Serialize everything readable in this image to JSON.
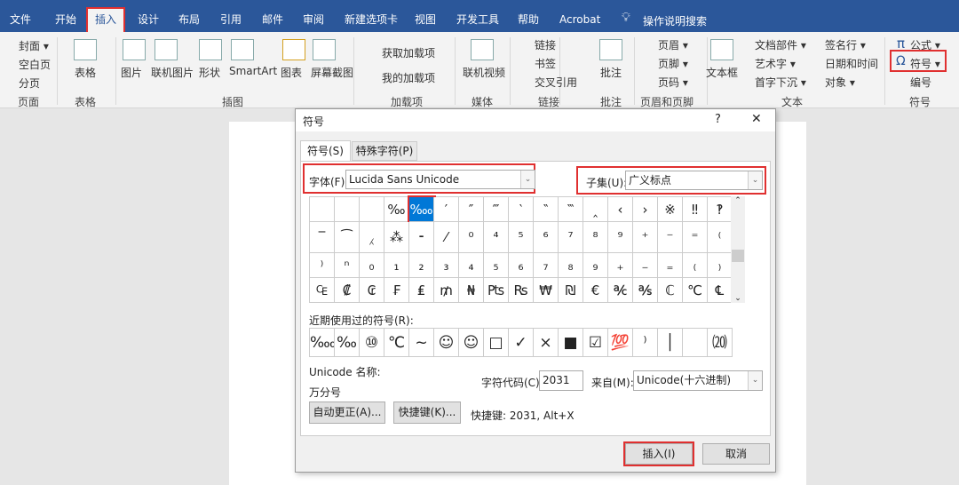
{
  "menu_tabs": [
    "文件",
    "开始",
    "插入",
    "设计",
    "布局",
    "引用",
    "邮件",
    "审阅",
    "新建选项卡",
    "视图",
    "开发工具",
    "帮助",
    "Acrobat"
  ],
  "active_tab": "插入",
  "tell_me": "操作说明搜索",
  "ribbon": {
    "pages": {
      "items": [
        "封面 ▾",
        "空白页",
        "分页"
      ],
      "label": "页面"
    },
    "tables": {
      "item": "表格",
      "label": "表格"
    },
    "illustrations": {
      "items": [
        "图片",
        "联机图片",
        "形状",
        "SmartArt",
        "图表",
        "屏幕截图"
      ],
      "label": "插图"
    },
    "addins": {
      "items": [
        "获取加载项",
        "我的加载项"
      ],
      "label": "加载项"
    },
    "media": {
      "item": "联机视频",
      "label": "媒体"
    },
    "links": {
      "items": [
        "链接",
        "书签",
        "交叉引用"
      ],
      "label": "链接"
    },
    "comments": {
      "item": "批注",
      "label": "批注"
    },
    "header_footer": {
      "items": [
        "页眉 ▾",
        "页脚 ▾",
        "页码 ▾"
      ],
      "label": "页眉和页脚"
    },
    "text": {
      "textbox": "文本框",
      "items": [
        "文档部件 ▾",
        "艺术字 ▾",
        "首字下沉 ▾",
        "签名行 ▾",
        "日期和时间",
        "对象 ▾"
      ],
      "label": "文本"
    },
    "symbols": {
      "items": [
        "公式 ▾",
        "符号 ▾",
        "编号"
      ],
      "label": "符号"
    }
  },
  "dialog": {
    "title": "符号",
    "help": "?",
    "close": "✕",
    "tabs": [
      "符号(S)",
      "特殊字符(P)"
    ],
    "font_label": "字体(F):",
    "font_value": "Lucida Sans Unicode",
    "subset_label": "子集(U):",
    "subset_value": "广义标点",
    "grid": [
      [
        "",
        "",
        "",
        "‰",
        "‱",
        "′",
        "″",
        "‴",
        "‵",
        "‶",
        "‷",
        "‸",
        "‹",
        "›",
        "※",
        "‼",
        "‽"
      ],
      [
        "‾",
        "⁀",
        "⁁",
        "⁂",
        "⁃",
        "⁄",
        "⁰",
        "⁴",
        "⁵",
        "⁶",
        "⁷",
        "⁸",
        "⁹",
        "⁺",
        "⁻",
        "⁼",
        "⁽"
      ],
      [
        "⁾",
        "ⁿ",
        "₀",
        "₁",
        "₂",
        "₃",
        "₄",
        "₅",
        "₆",
        "₇",
        "₈",
        "₉",
        "₊",
        "₋",
        "₌",
        "₍",
        "₎"
      ],
      [
        "₠",
        "₡",
        "₢",
        "₣",
        "₤",
        "₥",
        "₦",
        "₧",
        "₨",
        "₩",
        "₪",
        "€",
        "℀",
        "℁",
        "ℂ",
        "℃",
        "℄"
      ]
    ],
    "selected": "‱",
    "recent_label": "近期使用过的符号(R):",
    "recent": [
      "‱",
      "‰",
      "⑩",
      "℃",
      "~",
      "☺",
      "☺",
      "□",
      "✓",
      "×",
      "■",
      "☑",
      "💯",
      "⁾",
      "│",
      "",
      "⒇"
    ],
    "unicode_name_label": "Unicode 名称:",
    "unicode_name": "万分号",
    "char_code_label": "字符代码(C):",
    "char_code": "2031",
    "from_label": "来自(M):",
    "from_value": "Unicode(十六进制)",
    "autocorrect": "自动更正(A)...",
    "shortcut_key": "快捷键(K)...",
    "shortcut_text": "快捷键: 2031, Alt+X",
    "insert": "插入(I)",
    "cancel": "取消"
  }
}
